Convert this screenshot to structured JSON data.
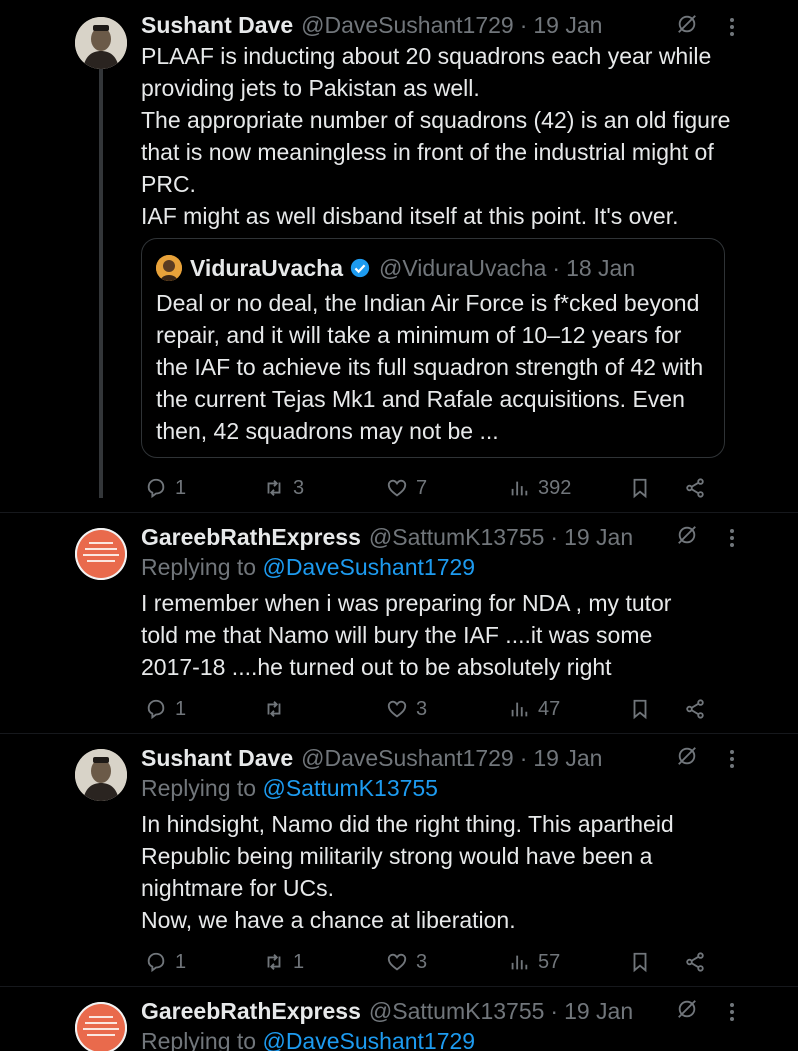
{
  "tweets": [
    {
      "name": "Sushant Dave",
      "handle": "@DaveSushant1729",
      "date": "19 Jan",
      "lines": [
        "PLAAF is inducting about 20 squadrons each year while providing jets to Pakistan as well.",
        "The appropriate number of squadrons (42) is an old figure that is now meaningless in front of the industrial might of PRC.",
        "IAF might as well disband itself at this point. It's over."
      ],
      "quote": {
        "name": "ViduraUvacha",
        "handle": "@ViduraUvacha",
        "date": "18 Jan",
        "text": "Deal or no deal, the Indian Air Force is f*cked beyond repair, and it will take a minimum of 10–12 years for the IAF to achieve its full squadron strength of 42 with the current Tejas Mk1 and Rafale acquisitions. Even then, 42 squadrons may not be ..."
      },
      "replies": "1",
      "reposts": "3",
      "likes": "7",
      "views": "392"
    },
    {
      "name": "GareebRathExpress",
      "handle": "@SattumK13755",
      "date": "19 Jan",
      "replying_prefix": "Replying to ",
      "replying_to": "@DaveSushant1729",
      "text": "I remember when i was preparing for NDA , my tutor told me that Namo will bury the IAF ....it was some 2017-18 ....he turned out to be absolutely right",
      "replies": "1",
      "reposts": "",
      "likes": "3",
      "views": "47"
    },
    {
      "name": "Sushant Dave",
      "handle": "@DaveSushant1729",
      "date": "19 Jan",
      "replying_prefix": "Replying to ",
      "replying_to": "@SattumK13755",
      "lines": [
        "In hindsight, Namo did the right thing. This apartheid Republic being militarily strong would have been a nightmare for UCs.",
        "Now, we have a chance at liberation."
      ],
      "replies": "1",
      "reposts": "1",
      "likes": "3",
      "views": "57"
    },
    {
      "name": "GareebRathExpress",
      "handle": "@SattumK13755",
      "date": "19 Jan",
      "replying_prefix": "Replying to ",
      "replying_to": "@DaveSushant1729"
    }
  ],
  "dot": "·",
  "colors": {
    "link": "#1d9bf0",
    "muted": "#71767b",
    "verified": "#1d9bf0"
  }
}
